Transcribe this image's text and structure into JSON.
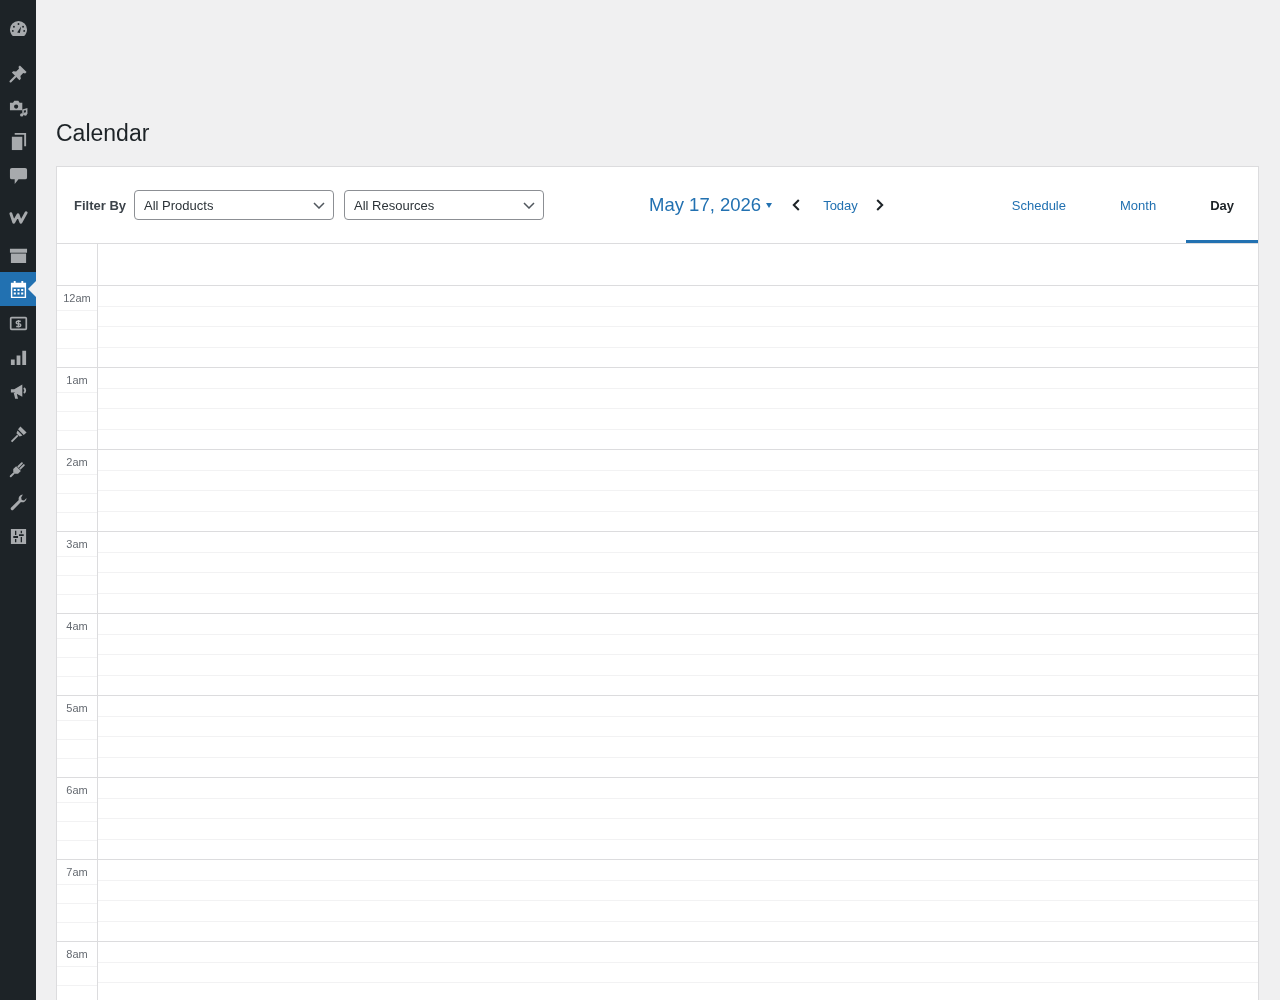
{
  "sidebar": {
    "items": [
      {
        "selected": false
      },
      {
        "selected": false
      },
      {
        "selected": false
      },
      {
        "selected": false
      },
      {
        "selected": false
      },
      {
        "selected": false
      },
      {
        "selected": false
      },
      {
        "selected": true
      },
      {
        "selected": false
      },
      {
        "selected": false
      },
      {
        "selected": false
      },
      {
        "selected": false
      },
      {
        "selected": false
      },
      {
        "selected": false
      },
      {
        "selected": false
      }
    ]
  },
  "page": {
    "title": "Calendar"
  },
  "toolbar": {
    "filter_label": "Filter By",
    "filters": [
      {
        "value": "All Products"
      },
      {
        "value": "All Resources"
      }
    ],
    "date": "May 17, 2026",
    "today": "Today",
    "views": [
      {
        "label": "Schedule",
        "selected": false
      },
      {
        "label": "Month",
        "selected": false
      },
      {
        "label": "Day",
        "selected": true
      }
    ]
  },
  "grid": {
    "hours": [
      "12am",
      "1am",
      "2am",
      "3am",
      "4am",
      "5am",
      "6am",
      "7am",
      "8am"
    ]
  }
}
